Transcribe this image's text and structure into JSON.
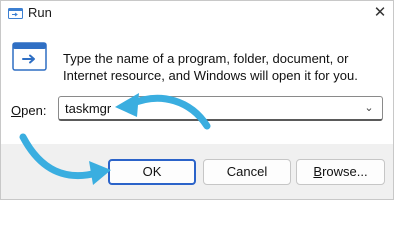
{
  "window": {
    "title": "Run",
    "close_glyph": "✕",
    "app_icon": "run-app-icon"
  },
  "dialog": {
    "icon": "run-icon",
    "description": "Type the name of a program, folder, document, or Internet resource, and Windows will open it for you.",
    "open_label_accel": "O",
    "open_label_rest": "pen:",
    "open_value": "taskmgr",
    "dropdown_glyph": "⌄"
  },
  "buttons": {
    "ok": "OK",
    "cancel": "Cancel",
    "browse_accel": "B",
    "browse_rest": "rowse..."
  },
  "annotation": {
    "arrow_color": "#3aaee0",
    "arrows": [
      "arrow-to-open-field",
      "arrow-to-ok-button"
    ]
  }
}
